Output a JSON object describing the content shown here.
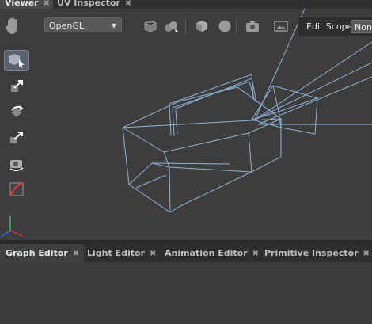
{
  "top_tabs": [
    {
      "label": "Viewer",
      "active": true
    },
    {
      "label": "UV Inspector",
      "active": false
    }
  ],
  "viewer": {
    "renderer": "OpenGL",
    "edit_scope_label": "Edit Scope",
    "edit_scope_value": "None",
    "left_tools": [
      "select-tool-icon",
      "translate-tool-icon",
      "rotate-tool-icon",
      "scale-tool-icon",
      "camera-tool-icon",
      "crop-window-icon"
    ],
    "top_icons": [
      "cube-wireframe-icon",
      "spheres-icon",
      "shaded-cube-icon",
      "sphere-icon",
      "camera-icon",
      "image-icon"
    ]
  },
  "bottom_tabs": [
    {
      "label": "Graph Editor",
      "active": true
    },
    {
      "label": "Light Editor",
      "active": false
    },
    {
      "label": "Animation Editor",
      "active": false
    },
    {
      "label": "Primitive Inspector",
      "active": false
    }
  ],
  "colors": {
    "wireframe": "#8fb3d9",
    "accent": "#7a8494"
  }
}
